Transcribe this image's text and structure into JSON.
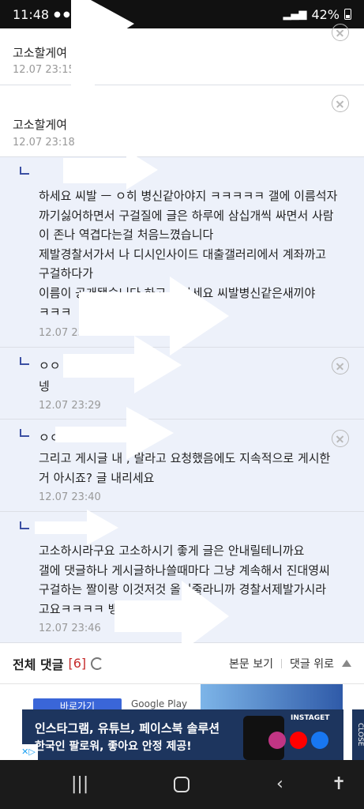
{
  "status_bar": {
    "time": "11:48",
    "battery": "42%"
  },
  "comments": [
    {
      "name": "고소할게여",
      "time": "12.07 23:15"
    },
    {
      "name": "고소할게여",
      "time": "12.07 23:18"
    }
  ],
  "replies": [
    {
      "lines": [
        "하세요 씨발 ㅡ ㅇ히 병신같아야지 ㅋㅋㅋㅋㅋ 갤에 이름석자",
        "까기싫어하면서 구걸질에 글은 하루에 삼십개씩 싸면서 사람",
        "이 존나 역겹다는걸 처음느꼈습니다",
        "제발경찰서가서 나 디시인사이드 대출갤러리에서 계좌까고",
        "구걸하다가",
        "이름이 공개됐습니다 하고 소하세요 씨발병신같은새끼야",
        "ㅋㅋㅋ"
      ],
      "time": "12.07 23:26"
    },
    {
      "name": "ㅇㅇ",
      "lines": [
        "넹"
      ],
      "time": "12.07 23:29"
    },
    {
      "name": "ㅇㅇ",
      "lines": [
        "그리고 게시글 내 , 랄라고 요청했음에도 지속적으로 게시한",
        "거 아시죠? 글 내리세요"
      ],
      "time": "12.07 23:40"
    },
    {
      "lines": [
        "고소하시라구요 고소하시기 좋게 글은 안내릴테니까요",
        "갤에 댓글하나 게시글하나쓸때마다 그냥 계속해서 진대영씨",
        "구걸하는 짤이랑 이것저것 올려줄라니까 경찰서제발가시라",
        "고요ㅋㅋㅋㅋ 뱅크"
      ],
      "time": "12.07 23:46"
    }
  ],
  "footer": {
    "title": "전체 댓글",
    "count": "[6]",
    "view_post": "본문 보기",
    "to_top": "댓글 위로"
  },
  "strip": {
    "button": "바로가기",
    "google_play": "Google Play"
  },
  "ad": {
    "line1": "인스타그램, 유튜브, 페이스북 솔루션",
    "line2": "한국인 팔로워, 좋아요 안정 제공!",
    "brand": "INSTAGET",
    "close": "CLOSE",
    "social_colors": [
      "#c13584",
      "#ff0000",
      "#1877f2"
    ]
  },
  "colors": {
    "reply_bg": "#edf1fa",
    "count_red": "#c62b2b",
    "reply_mark": "#3b4fa3"
  },
  "icons": [
    "delete-circle-icon",
    "refresh-icon",
    "up-arrow-icon",
    "menu-icon",
    "home-icon",
    "back-icon",
    "accessibility-icon"
  ]
}
